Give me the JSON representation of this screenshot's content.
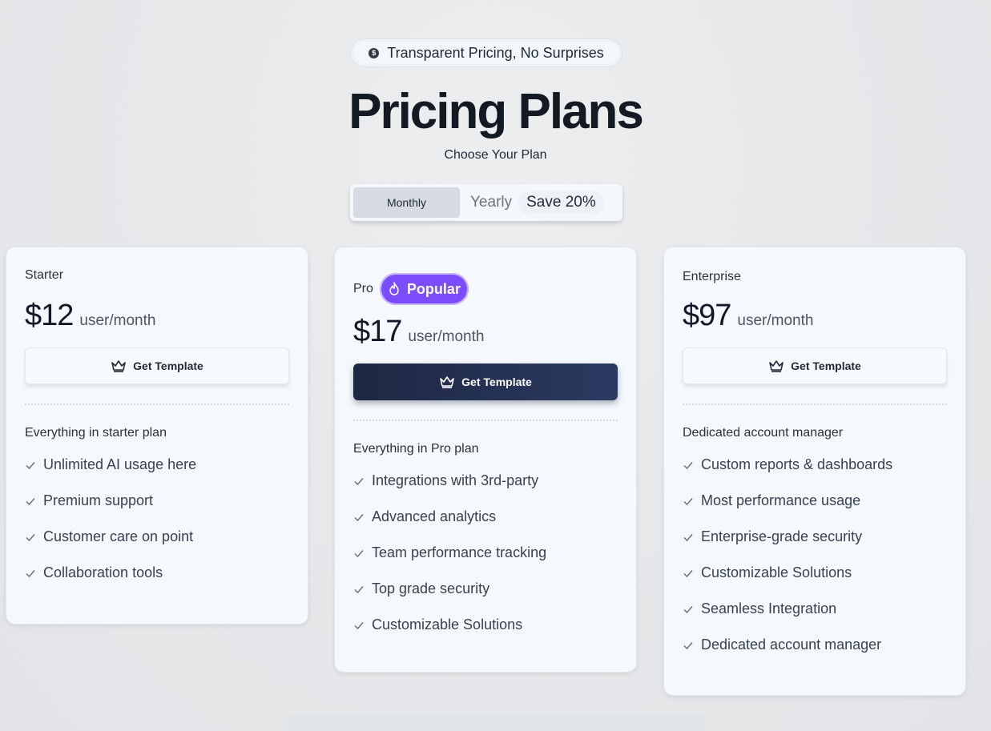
{
  "header": {
    "badge_text": "Transparent Pricing, No Surprises",
    "title": "Pricing Plans",
    "subtitle": "Choose Your Plan"
  },
  "billing_toggle": {
    "monthly_label": "Monthly",
    "yearly_label": "Yearly",
    "save_badge": "Save 20%",
    "selected": "Monthly"
  },
  "plans": [
    {
      "name": "Starter",
      "price": "$12",
      "unit": "user/month",
      "cta_label": "Get Template",
      "feature_heading": "Everything in starter plan",
      "features": [
        "Unlimited AI usage here",
        "Premium support",
        "Customer care on point",
        "Collaboration tools"
      ]
    },
    {
      "name": "Pro",
      "badge": "Popular",
      "price": "$17",
      "unit": "user/month",
      "cta_label": "Get Template",
      "feature_heading": "Everything in Pro plan",
      "features": [
        "Integrations with 3rd-party",
        "Advanced analytics",
        "Team performance tracking",
        "Top grade security",
        "Customizable Solutions"
      ]
    },
    {
      "name": "Enterprise",
      "price": "$97",
      "unit": "user/month",
      "cta_label": "Get Template",
      "feature_heading": "Dedicated account manager",
      "features": [
        "Custom reports & dashboards",
        "Most performance usage",
        "Enterprise-grade security",
        "Customizable Solutions",
        "Seamless Integration",
        "Dedicated account manager"
      ]
    }
  ],
  "colors": {
    "accent_purple": "#7c4dff",
    "cta_dark": "#1e2742",
    "card_bg": "#f5f9fd",
    "page_bg": "#e6e8ea"
  },
  "icons": {
    "badge": "coin-icon",
    "popular": "flame-icon",
    "cta": "crown-icon",
    "feature": "check-icon"
  }
}
